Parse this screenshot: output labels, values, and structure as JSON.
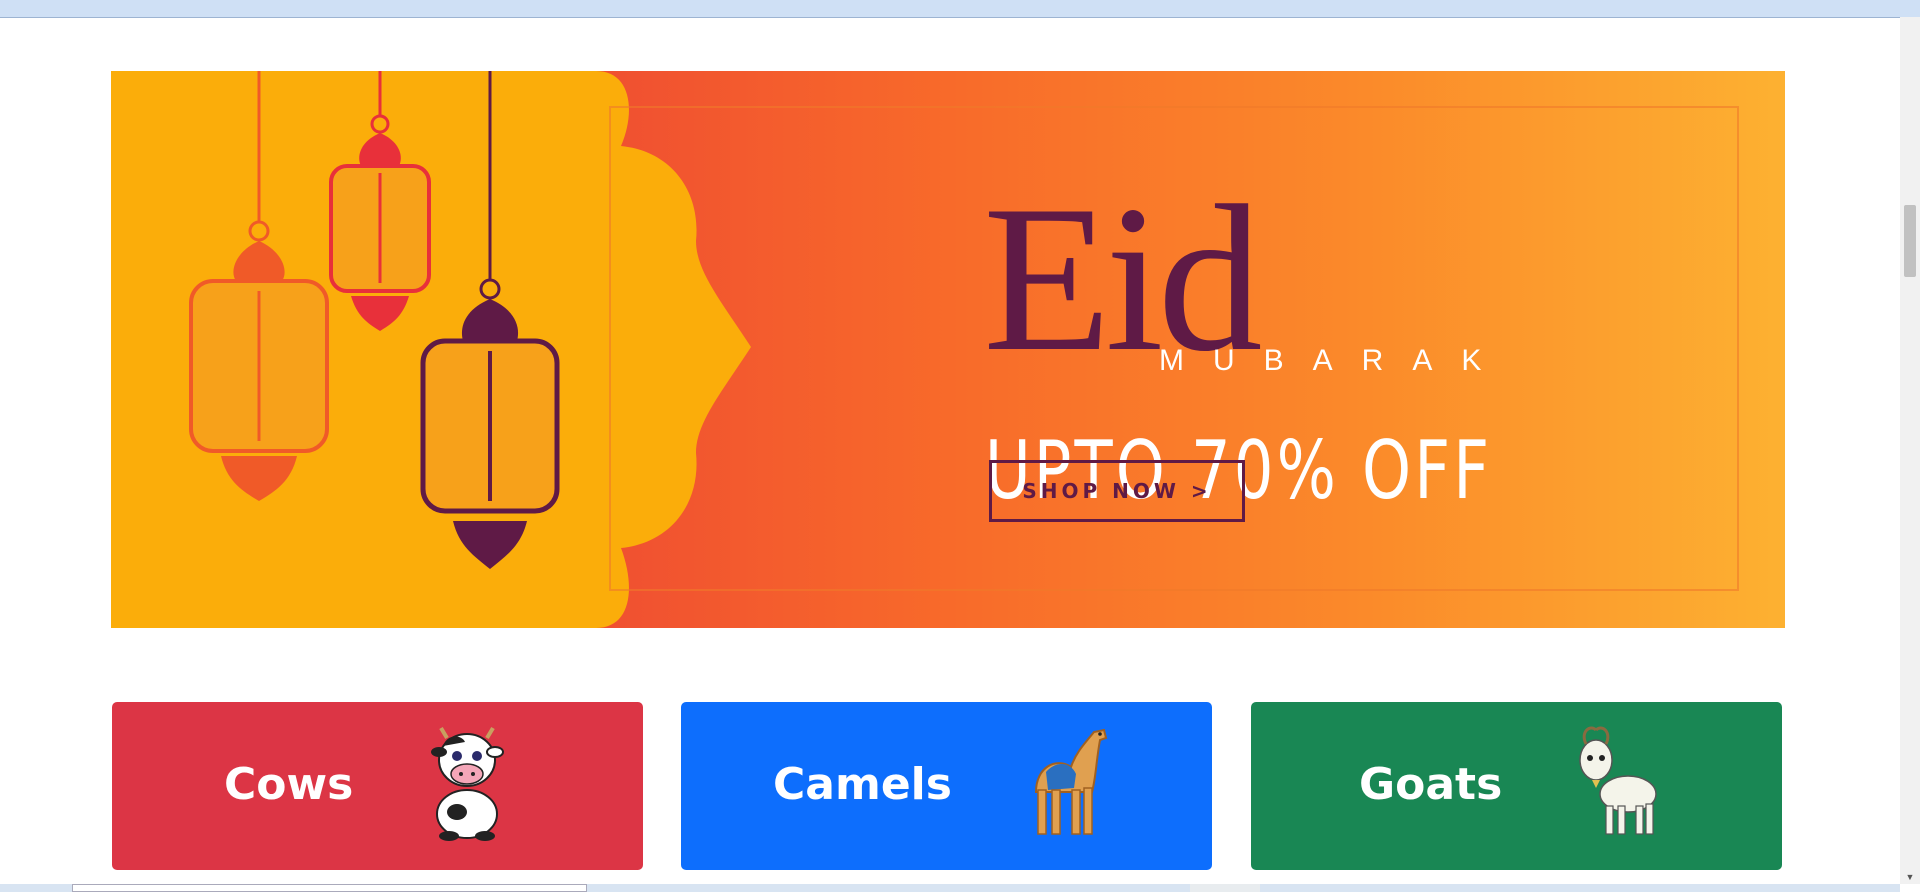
{
  "banner": {
    "eid_title": "Eid",
    "eid_subtitle": "MUBARAK",
    "offer_text": "UPTO 70% OFF",
    "shop_button_label": "SHOP NOW >"
  },
  "categories": [
    {
      "label": "Cows",
      "icon": "cow-icon",
      "color": "#dc3545"
    },
    {
      "label": "Camels",
      "icon": "camel-icon",
      "color": "#0d6efd"
    },
    {
      "label": "Goats",
      "icon": "goat-icon",
      "color": "#198754"
    }
  ],
  "colors": {
    "banner_yellow": "#fbad0a",
    "banner_plum": "#5f1a46",
    "banner_gradient_start": "#e8303a",
    "banner_gradient_end": "#fdb131"
  }
}
